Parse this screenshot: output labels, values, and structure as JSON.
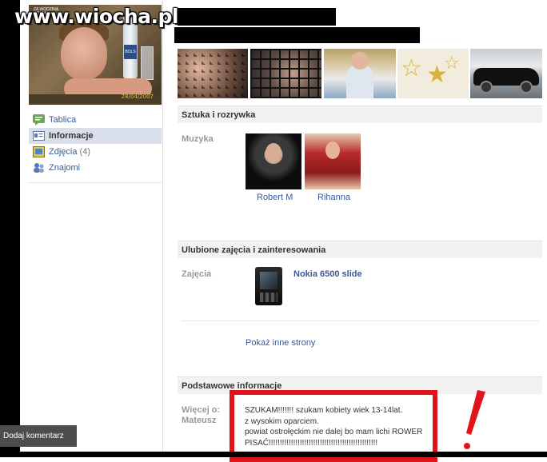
{
  "watermark": "www.wiocha.pl",
  "profile": {
    "photo_date": "28/04/2007",
    "photo_caption": "ZA WODZINĄ SZKOŁĄ",
    "bottle_label": "BOLS"
  },
  "nav": {
    "items": [
      {
        "label": "Tablica",
        "count": "",
        "icon": "wall-icon"
      },
      {
        "label": "Informacje",
        "count": "",
        "icon": "info-icon"
      },
      {
        "label": "Zdjęcia",
        "count": "(4)",
        "icon": "photos-icon"
      },
      {
        "label": "Znajomi",
        "count": "",
        "icon": "friends-icon"
      }
    ]
  },
  "sections": {
    "arts": {
      "title": "Sztuka i rozrywka",
      "music_label": "Muzyka",
      "artists": [
        {
          "name": "Robert M"
        },
        {
          "name": "Rihanna"
        }
      ]
    },
    "interests": {
      "title": "Ulubione zajęcia i zainteresowania",
      "activities_label": "Zajęcia",
      "activity": "Nokia 6500 slide",
      "more_link": "Pokaż inne strony"
    },
    "basic": {
      "title": "Podstawowe informacje",
      "more_about_label_1": "Więcej o:",
      "more_about_label_2": "Mateusz",
      "about_lines": [
        "SZUKAM!!!!!!! szukam kobiety wiek 13-14lat.",
        "z wysokim oparciem.",
        "powiat ostrołęckim nie dalej bo mam lichi ROWER",
        "PISAĆ!!!!!!!!!!!!!!!!!!!!!!!!!!!!!!!!!!!!!!!!!!!!!!!!!"
      ]
    }
  },
  "overlay": {
    "comment_button": "Dodaj komentarz",
    "highlight_color": "#e0151b"
  },
  "colors": {
    "link": "#3b5998",
    "nav_selected": "#d8dfea",
    "section_bg": "#f2f2f2"
  }
}
